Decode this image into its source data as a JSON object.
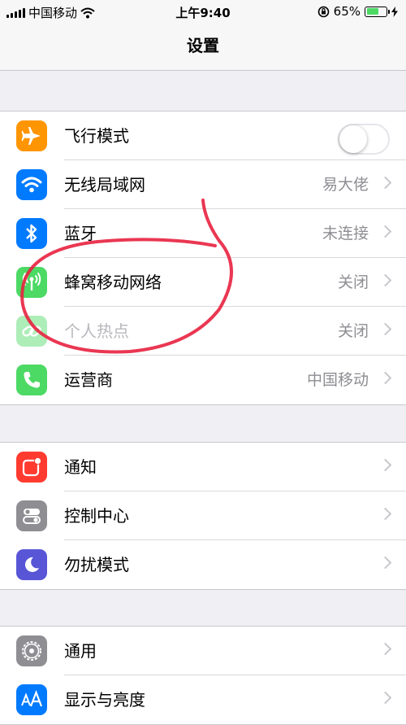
{
  "status_bar": {
    "carrier": "中国移动",
    "time": "上午9:40",
    "battery_percent": "65%",
    "battery_level": 0.65
  },
  "navbar": {
    "title": "设置"
  },
  "groups": [
    {
      "rows": [
        {
          "label": "飞行模式",
          "value": "",
          "icon": "airplane-icon",
          "color": "#ff9500",
          "toggle_on": false
        },
        {
          "label": "无线局域网",
          "value": "易大佬",
          "icon": "wifi-icon",
          "color": "#007aff"
        },
        {
          "label": "蓝牙",
          "value": "未连接",
          "icon": "bluetooth-icon",
          "color": "#007aff"
        },
        {
          "label": "蜂窝移动网络",
          "value": "关闭",
          "icon": "cellular-antenna-icon",
          "color": "#4cd964"
        },
        {
          "label": "个人热点",
          "value": "关闭",
          "icon": "hotspot-link-icon",
          "color": "#4cd964",
          "disabled": true
        },
        {
          "label": "运营商",
          "value": "中国移动",
          "icon": "phone-icon",
          "color": "#4cd964"
        }
      ]
    },
    {
      "rows": [
        {
          "label": "通知",
          "value": "",
          "icon": "notifications-icon",
          "color": "#ff3b30"
        },
        {
          "label": "控制中心",
          "value": "",
          "icon": "control-center-icon",
          "color": "#8e8e93"
        },
        {
          "label": "勿扰模式",
          "value": "",
          "icon": "moon-icon",
          "color": "#5856d6"
        }
      ]
    },
    {
      "rows": [
        {
          "label": "通用",
          "value": "",
          "icon": "gear-icon",
          "color": "#8e8e93"
        },
        {
          "label": "显示与亮度",
          "value": "",
          "icon": "display-text-size-icon",
          "color": "#007aff"
        }
      ]
    }
  ]
}
